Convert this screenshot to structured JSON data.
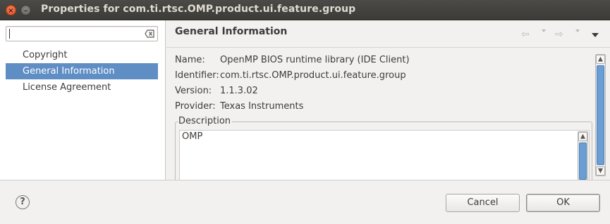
{
  "window": {
    "title": "Properties for com.ti.rtsc.OMP.product.ui.feature.group",
    "close_glyph": "×",
    "minimize_glyph": "–"
  },
  "sidebar": {
    "filter": {
      "value": "",
      "placeholder": ""
    },
    "items": [
      {
        "label": "Copyright",
        "selected": false
      },
      {
        "label": "General Information",
        "selected": true
      },
      {
        "label": "License Agreement",
        "selected": false
      }
    ]
  },
  "page": {
    "title": "General Information",
    "nav": {
      "back": "⇦",
      "forward": "⇨"
    }
  },
  "info": {
    "name_label": "Name:",
    "name_value": "OpenMP BIOS runtime library (IDE Client)",
    "identifier_label": "Identifier:",
    "identifier_value": "com.ti.rtsc.OMP.product.ui.feature.group",
    "version_label": "Version:",
    "version_value": "1.1.3.02",
    "provider_label": "Provider:",
    "provider_value": "Texas Instruments",
    "description_label": "Description",
    "description_text": "OMP"
  },
  "buttons": {
    "help": "?",
    "cancel": "Cancel",
    "ok": "OK"
  },
  "colors": {
    "selection": "#5f8ec5",
    "close_button": "#df4a16",
    "scroll_thumb": "#6b9ed4"
  },
  "icons": {
    "clear": "clear-filter-icon",
    "back": "back-arrow-icon",
    "forward": "forward-arrow-icon",
    "menu": "view-menu-icon",
    "help": "help-icon"
  }
}
